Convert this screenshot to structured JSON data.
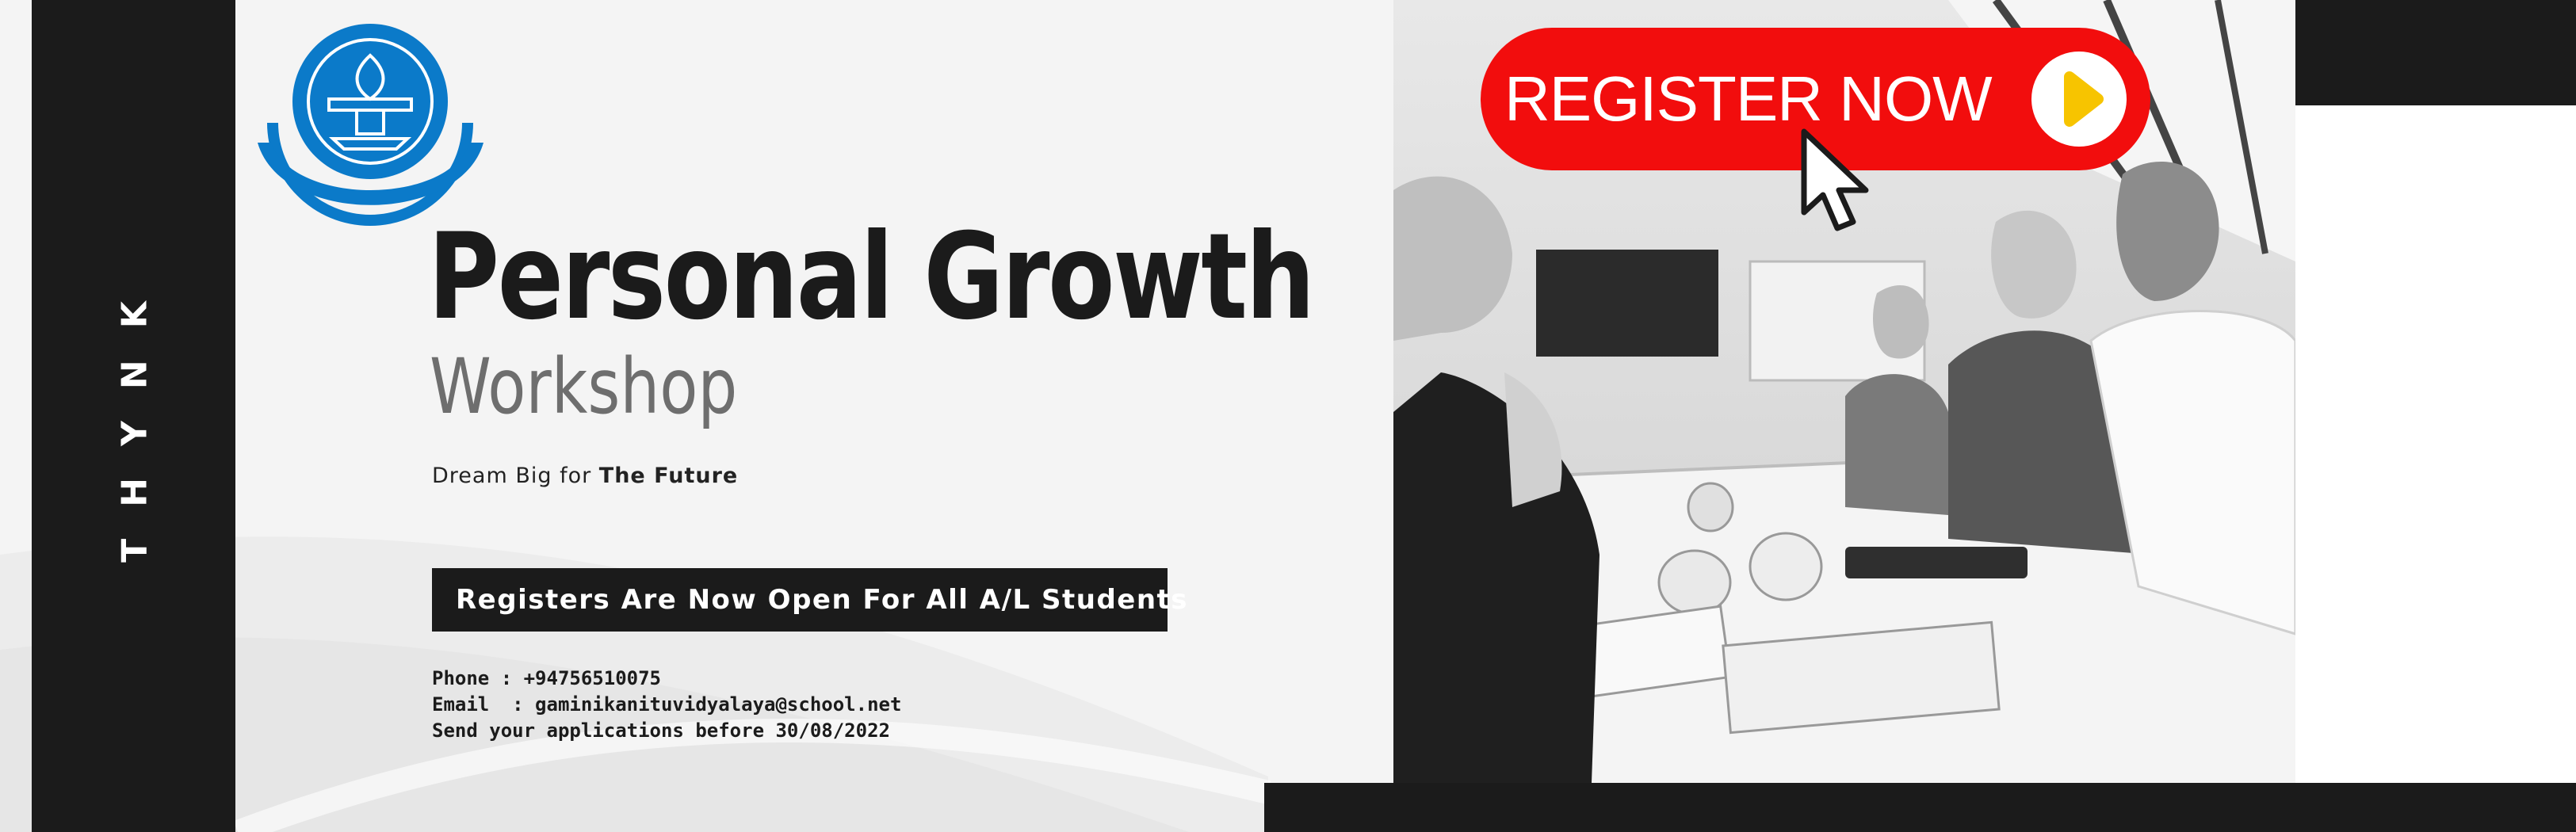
{
  "brand": {
    "vertical_text": "THYNK"
  },
  "logo": {
    "icon": "school-crest-icon",
    "color": "#0b7ac9"
  },
  "headline": {
    "title": "Personal Growth",
    "subtitle": "Workshop",
    "tagline_prefix": "Dream Big for ",
    "tagline_emphasis": "The Future"
  },
  "banner": {
    "text": "Registers Are Now Open For All A/L Students"
  },
  "contact": {
    "phone_line": "Phone : +94756510075",
    "email_line": "Email  : gaminikanituvidyalaya@school.net",
    "deadline_line": "Send your applications before 30/08/2022"
  },
  "cta": {
    "label": "REGISTER NOW",
    "button_color": "#f20d0d",
    "play_icon": "play-arrow-icon",
    "play_icon_color": "#f7c400",
    "cursor_icon": "mouse-pointer-icon"
  },
  "photo": {
    "description_icon": "meeting-photo"
  },
  "colors": {
    "dark": "#1b1b1b",
    "grey_text": "#6e6e6e",
    "background": "#f4f4f4"
  }
}
